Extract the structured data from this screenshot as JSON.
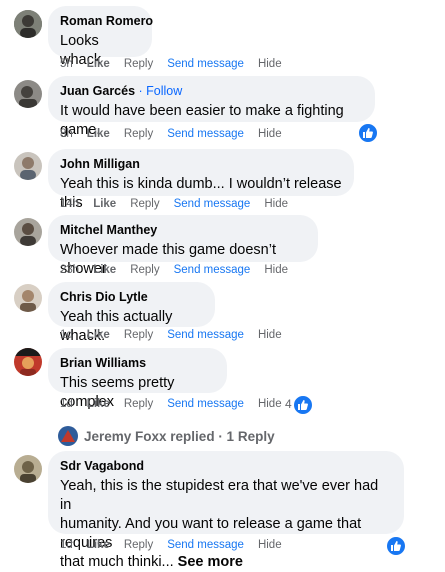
{
  "colors": {
    "bubble": "#f0f2f5",
    "meta": "#65676b",
    "link": "#1877f2",
    "like_badge": "#1877f2"
  },
  "comments": [
    {
      "author": "Roman Romero",
      "text": "Looks whack",
      "time": "5h",
      "like": "Like",
      "reply": "Reply",
      "send": "Send message",
      "hide": "Hide"
    },
    {
      "author": "Juan Garcés",
      "follow": " · Follow",
      "text": "It would have been easier to make a fighting game.",
      "time": "8h",
      "like": "Like",
      "reply": "Reply",
      "send": "Send message",
      "hide": "Hide",
      "reactions": "like-icon"
    },
    {
      "author": "John Milligan",
      "text": "Yeah this is kinda dumb... I wouldn’t release this",
      "time": "14h",
      "like": "Like",
      "reply": "Reply",
      "send": "Send message",
      "hide": "Hide"
    },
    {
      "author": "Mitchel Manthey",
      "text": "Whoever made this game doesn’t shower",
      "time": "23h",
      "like": "Like",
      "reply": "Reply",
      "send": "Send message",
      "hide": "Hide"
    },
    {
      "author": "Chris Dio Lytle",
      "text": "Yeah this actually whack.",
      "time": "1d",
      "like": "Like",
      "reply": "Reply",
      "send": "Send message",
      "hide": "Hide"
    },
    {
      "author": "Brian Williams",
      "text": "This seems pretty complex",
      "time": "1d",
      "like": "Like",
      "reply": "Reply",
      "send": "Send message",
      "hide": "Hide",
      "reaction_count": "4"
    },
    {
      "author": "Sdr Vagabond",
      "text_lines": [
        "Yeah, this is the stupidest era that we've ever had in",
        "humanity. And you want to release a game that requires",
        "that much thinki... "
      ],
      "see_more": "See more",
      "time": "1d",
      "like": "Like",
      "reply": "Reply",
      "send": "Send message",
      "hide": "Hide"
    }
  ],
  "replies_link": "Jeremy Foxx replied · 1 Reply"
}
